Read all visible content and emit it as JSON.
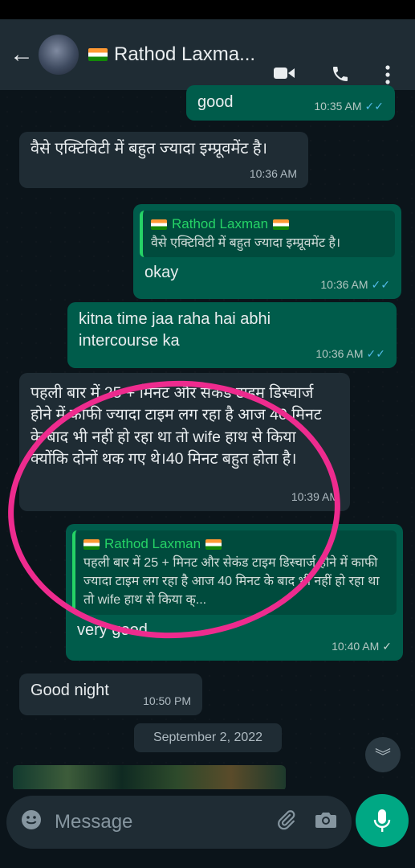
{
  "header": {
    "back_icon": "arrow-left-icon",
    "contact_name": "Rathod Laxma...",
    "video_icon": "video-call-icon",
    "call_icon": "phone-icon",
    "menu_icon": "more-vert-icon"
  },
  "messages": [
    {
      "dir": "out",
      "text": "good",
      "time": "10:35 AM",
      "status": "read"
    },
    {
      "dir": "in",
      "text": "वैसे एक्टिविटी में बहुत ज्यादा इम्प्रूवमेंट है।",
      "time": "10:36 AM"
    },
    {
      "dir": "out",
      "quote_name": "Rathod Laxman",
      "quote_text": "वैसे एक्टिविटी में बहुत ज्यादा इम्प्रूवमेंट है।",
      "text": "okay",
      "time": "10:36 AM",
      "status": "read"
    },
    {
      "dir": "out",
      "text": "kitna time jaa raha hai abhi intercourse ka",
      "time": "10:36 AM",
      "status": "read"
    },
    {
      "dir": "in",
      "text": "पहली बार में 25 + मिनट और सेकंड टाइम डिस्चार्ज होने में काफी ज्यादा टाइम लग रहा है आज 40 मिनट के बाद भी नहीं हो रहा था तो wife हाथ से किया क्योंकि दोनों थक गए थे।40 मिनट बहुत होता है।",
      "time": "10:39 AM"
    },
    {
      "dir": "out",
      "quote_name": "Rathod Laxman",
      "quote_text": "पहली बार में 25 + मिनट और सेकंड टाइम डिस्चार्ज होने में काफी ज्यादा टाइम लग रहा है आज 40 मिनट के बाद भी नहीं हो रहा था तो wife हाथ से किया क्...",
      "text": "very good",
      "time": "10:40 AM",
      "status": "delivered"
    },
    {
      "dir": "in",
      "text": "Good night",
      "time": "10:50 PM"
    }
  ],
  "date_separator": "September 2, 2022",
  "composer": {
    "placeholder": "Message",
    "emoji_icon": "emoji-icon",
    "attach_icon": "paperclip-icon",
    "camera_icon": "camera-icon",
    "mic_icon": "microphone-icon"
  },
  "colors": {
    "background": "#0b141a",
    "incoming_bubble": "#1f2c34",
    "outgoing_bubble": "#005c4b",
    "accent": "#00a884",
    "read_tick": "#53bdeb",
    "annotation": "#ee2b8e"
  }
}
